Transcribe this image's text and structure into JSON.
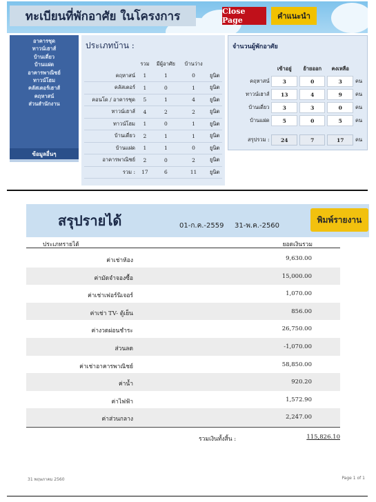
{
  "top": {
    "title": "ทะเบียนที่พักอาศัย ในโครงการ",
    "close_label": "Close Page",
    "help_label": "คำแนะนำ",
    "sidebar_items": [
      "อาคารชุด",
      "ทาวน์เฮาส์",
      "บ้านเดี่ยว",
      "บ้านแฝด",
      "อาคารพาณิชย์",
      "ทาวน์โฮม",
      "คลัสเตอร์เฮาส์",
      "คฤหาสน์",
      "ส่วนสำนักงาน"
    ],
    "sidebar_last": "ข้อมูลอื่นๆ",
    "house_types": {
      "title": "ประเภทบ้าน :",
      "headers": [
        "",
        "รวม",
        "มีผู้อาศัย",
        "บ้านว่าง",
        ""
      ],
      "rows": [
        [
          "คฤหาสน์",
          "1",
          "1",
          "0",
          "ยูนิต"
        ],
        [
          "คลัสเตอร์",
          "1",
          "0",
          "1",
          "ยูนิต"
        ],
        [
          "คอนโด / อาคารชุด",
          "5",
          "1",
          "4",
          "ยูนิต"
        ],
        [
          "ทาวน์เฮาส์",
          "4",
          "2",
          "2",
          "ยูนิต"
        ],
        [
          "ทาวน์โฮม",
          "1",
          "0",
          "1",
          "ยูนิต"
        ],
        [
          "บ้านเดี่ยว",
          "2",
          "1",
          "1",
          "ยูนิต"
        ],
        [
          "บ้านแฝด",
          "1",
          "1",
          "0",
          "ยูนิต"
        ],
        [
          "อาคารพาณิชย์",
          "2",
          "0",
          "2",
          "ยูนิต"
        ],
        [
          "รวม :",
          "17",
          "6",
          "11",
          "ยูนิต"
        ]
      ]
    },
    "residents": {
      "title": "จำนวนผู้พักอาศัย",
      "headers": [
        "",
        "เข้าอยู่",
        "ย้ายออก",
        "คงเหลือ",
        ""
      ],
      "rows": [
        [
          "คฤหาสน์",
          "3",
          "0",
          "3",
          "คน"
        ],
        [
          "ทาวน์เฮาส์",
          "13",
          "4",
          "9",
          "คน"
        ],
        [
          "บ้านเดี่ยว",
          "3",
          "3",
          "0",
          "คน"
        ],
        [
          "บ้านแฝด",
          "5",
          "0",
          "5",
          "คน"
        ]
      ],
      "total": [
        "สรุปรวม :",
        "24",
        "7",
        "17",
        "คน"
      ]
    }
  },
  "report": {
    "title": "สรุปรายได้",
    "date_from": "01-ก.ค.-2559",
    "date_to": "31-พ.ค.-2560",
    "print_label": "พิมพ์รายงาน",
    "col_type": "ประเภทรายได้",
    "col_amount": "ยอดเงินรวม",
    "rows": [
      {
        "name": "ค่าเช่าห้อง",
        "value": "9,630.00"
      },
      {
        "name": "ค่ามัดจำจองซื้อ",
        "value": "15,000.00"
      },
      {
        "name": "ค่าเช่าเฟอร์นิเจอร์",
        "value": "1,070.00"
      },
      {
        "name": "ค่าเช่า TV- ตู้เย็น",
        "value": "856.00"
      },
      {
        "name": "ค่างวดผ่อนชำระ",
        "value": "26,750.00"
      },
      {
        "name": "ส่วนลด",
        "value": "-1,070.00"
      },
      {
        "name": "ค่าเช่าอาคารพาณิชย์",
        "value": "58,850.00"
      },
      {
        "name": "ค่าน้ำ",
        "value": "920.20"
      },
      {
        "name": "ค่าไฟฟ้า",
        "value": "1,572.90"
      },
      {
        "name": "ค่าส่วนกลาง",
        "value": "2,247.00"
      }
    ],
    "total_label": "รวมเงินทั้งสิ้น :",
    "total_value": "115,826.10",
    "footer_date": "31 พฤษภาคม 2560",
    "footer_page": "Page 1 of 1"
  }
}
